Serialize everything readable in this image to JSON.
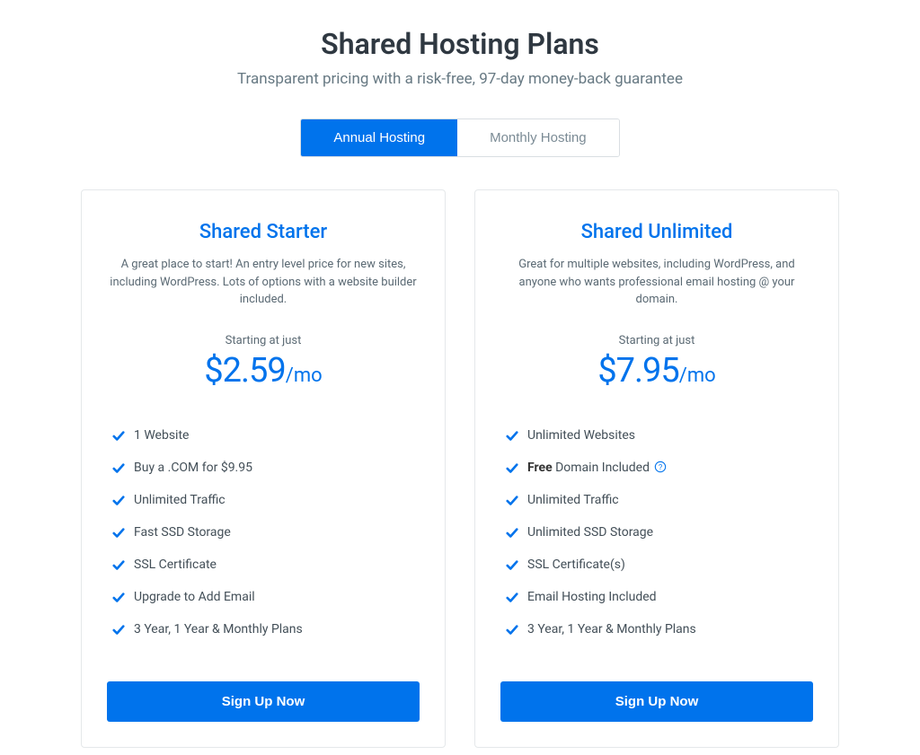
{
  "header": {
    "title": "Shared Hosting Plans",
    "subtitle": "Transparent pricing with a risk-free, 97-day money-back guarantee"
  },
  "tabs": {
    "annual": "Annual Hosting",
    "monthly": "Monthly Hosting"
  },
  "plans": [
    {
      "name": "Shared Starter",
      "desc": "A great place to start! An entry level price for new sites, including WordPress. Lots of options with a website builder included.",
      "starting_label": "Starting at just",
      "price": "$2.59",
      "period": "/mo",
      "cta": "Sign Up Now",
      "features": [
        {
          "text": "1 Website"
        },
        {
          "text": "Buy a .COM for $9.95"
        },
        {
          "text": "Unlimited Traffic"
        },
        {
          "text": "Fast SSD Storage"
        },
        {
          "text": "SSL Certificate"
        },
        {
          "text": "Upgrade to Add Email"
        },
        {
          "text": "3 Year, 1 Year & Monthly Plans"
        }
      ]
    },
    {
      "name": "Shared Unlimited",
      "desc": "Great for multiple websites, including WordPress, and anyone who wants professional email hosting @ your domain.",
      "starting_label": "Starting at just",
      "price": "$7.95",
      "period": "/mo",
      "cta": "Sign Up Now",
      "features": [
        {
          "text": "Unlimited Websites"
        },
        {
          "bold": "Free",
          "text": " Domain Included",
          "help": true
        },
        {
          "text": "Unlimited Traffic"
        },
        {
          "text": "Unlimited SSD Storage"
        },
        {
          "text": "SSL Certificate(s)"
        },
        {
          "text": "Email Hosting Included"
        },
        {
          "text": "3 Year, 1 Year & Monthly Plans"
        }
      ]
    }
  ],
  "colors": {
    "primary": "#0073ec"
  }
}
